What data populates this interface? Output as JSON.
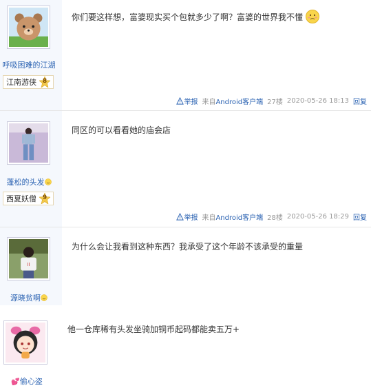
{
  "posts": [
    {
      "username": "呼吸困难的江湖",
      "level_title": "江南游侠",
      "level_num": "8",
      "content": "你们要这样想，富婆现实买个包就多少了啊？富婆的世界我不懂",
      "report": "举报",
      "from_prefix": "来自",
      "client": "Android客户端",
      "floor": "27楼",
      "time": "2020-05-26 18:13",
      "reply": "回复"
    },
    {
      "username": "蓬松的头发",
      "level_title": "西夏妖僧",
      "level_num": "9",
      "content": "同区的可以看看她的庙会店",
      "report": "举报",
      "from_prefix": "来自",
      "client": "Android客户端",
      "floor": "28楼",
      "time": "2020-05-26 18:29",
      "reply": "回复"
    },
    {
      "username": "源晓贫啊",
      "content": "为什么会让我看到这种东西？我承受了这个年龄不该承受的重量"
    },
    {
      "username": "偷心盗",
      "content": "他一仓库稀有头发坐骑加铜币起码都能卖五万+"
    }
  ],
  "colors": {
    "link": "#2d64b3",
    "sidebar": "#f5f8fd",
    "meta": "#999999"
  }
}
